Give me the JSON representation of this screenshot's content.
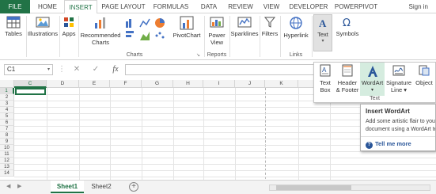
{
  "ribbon_tabs": [
    {
      "label": "FILE"
    },
    {
      "label": "HOME"
    },
    {
      "label": "INSERT"
    },
    {
      "label": "PAGE LAYOUT"
    },
    {
      "label": "FORMULAS"
    },
    {
      "label": "DATA"
    },
    {
      "label": "REVIEW"
    },
    {
      "label": "VIEW"
    },
    {
      "label": "DEVELOPER"
    },
    {
      "label": "POWERPIVOT"
    }
  ],
  "active_tab": "INSERT",
  "sign_in": "Sign in",
  "ribbon": {
    "tables": "Tables",
    "illustrations": "Illustrations",
    "apps": "Apps",
    "recommended_charts_1": "Recommended",
    "recommended_charts_2": "Charts",
    "pivotchart": "PivotChart",
    "power_view_1": "Power",
    "power_view_2": "View",
    "sparklines": "Sparklines",
    "filters": "Filters",
    "hyperlink": "Hyperlink",
    "text": "Text",
    "symbols": "Symbols",
    "group_charts": "Charts",
    "group_reports": "Reports",
    "group_links": "Links"
  },
  "formula_bar": {
    "name_box": "C1",
    "fx": "fx"
  },
  "grid": {
    "columns": [
      "C",
      "D",
      "E",
      "F",
      "G",
      "H",
      "I",
      "J",
      "K"
    ],
    "rows": [
      "1",
      "2",
      "3",
      "4",
      "5",
      "6",
      "7",
      "8",
      "9",
      "10",
      "11",
      "12",
      "13",
      "14"
    ],
    "active_cell": "C1"
  },
  "sheets": {
    "tabs": [
      "Sheet1",
      "Sheet2"
    ],
    "active": "Sheet1"
  },
  "text_panel": {
    "items": [
      {
        "line1": "Text",
        "line2": "Box"
      },
      {
        "line1": "Header",
        "line2": "& Footer"
      },
      {
        "line1": "WordArt",
        "line2": "▾"
      },
      {
        "line1": "Signature",
        "line2": "Line ▾"
      },
      {
        "line1": "Object",
        "line2": ""
      }
    ],
    "group_label": "Text"
  },
  "tooltip": {
    "title": "Insert WordArt",
    "desc_1": "Add some artistic flair to your",
    "desc_2": "document using a WordArt text box.",
    "tell_more": "Tell me more"
  },
  "colors": {
    "accent": "#217346",
    "wordart": "#2a5699"
  }
}
